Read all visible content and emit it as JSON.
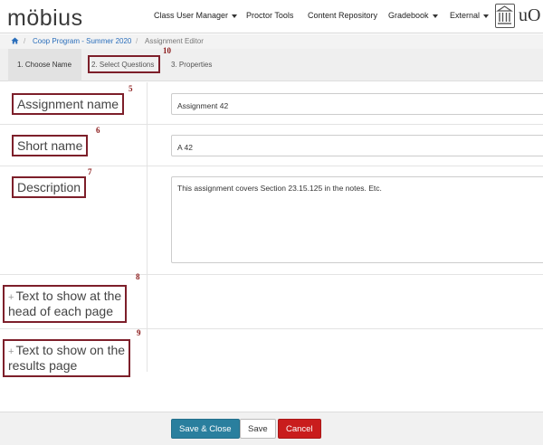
{
  "app": {
    "logo": "möbius",
    "institution_mark": "uO"
  },
  "nav": {
    "class_user_manager": "Class User Manager",
    "proctor_tools": "Proctor Tools",
    "content_repository": "Content Repository",
    "gradebook": "Gradebook",
    "external": "External"
  },
  "breadcrumb": {
    "home_icon": "home-icon",
    "course": "Coop Program - Summer 2020",
    "current": "Assignment Editor",
    "separator": "/"
  },
  "wizard": {
    "step1": "1. Choose Name",
    "step2": "2. Select Questions",
    "step3": "3. Properties"
  },
  "annotations": {
    "n5": "5",
    "n6": "6",
    "n7": "7",
    "n8": "8",
    "n9": "9",
    "n10": "10"
  },
  "form": {
    "assignment_name_label": "Assignment name",
    "assignment_name_value": "Assignment 42",
    "short_name_label": "Short name",
    "short_name_value": "A 42",
    "description_label": "Description",
    "description_value": "This assignment covers Section 23.15.125 in the notes.  Etc.",
    "head_text_label_line1": "Text to show at the",
    "head_text_label_line2": "head of each page",
    "results_text_label_line1": "Text to show on the",
    "results_text_label_line2": "results page",
    "expand_symbol": "+"
  },
  "footer": {
    "save_close": "Save & Close",
    "save": "Save",
    "cancel": "Cancel"
  },
  "colors": {
    "annotation_border": "#7d1f2a",
    "primary_button": "#2a7f9e",
    "danger_button": "#c91d1d",
    "link": "#2a6ebb"
  }
}
